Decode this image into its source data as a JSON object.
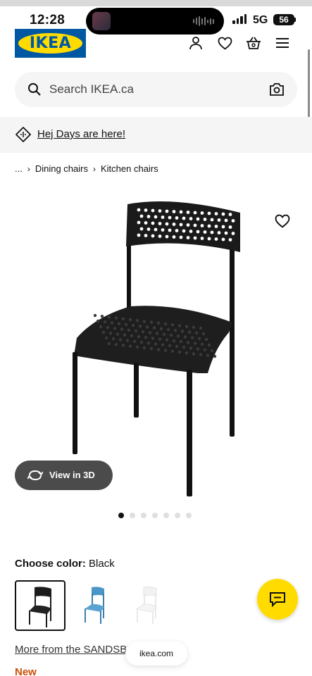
{
  "status_bar": {
    "time": "12:28",
    "network": "5G",
    "battery": "56"
  },
  "header": {
    "logo_text": "IKEA",
    "icons": [
      "profile-icon",
      "heart-icon",
      "basket-icon",
      "menu-icon"
    ]
  },
  "search": {
    "placeholder": "Search IKEA.ca"
  },
  "promo": {
    "label": "Hej Days are here!"
  },
  "breadcrumb": {
    "ellipsis": "...",
    "items": [
      "Dining chairs",
      "Kitchen chairs"
    ]
  },
  "product": {
    "view_3d_label": "View in 3D",
    "image_dots_total": 7,
    "image_dots_active": 1
  },
  "color": {
    "label": "Choose color:",
    "selected": "Black",
    "swatches": [
      {
        "color": "#1b1b1b"
      },
      {
        "color": "#4a96c6"
      },
      {
        "color": "#f2f2f2"
      }
    ]
  },
  "series_link": "More from the SANDSBERG series",
  "url": "ikea.com",
  "badge": "New",
  "colors": {
    "ikea_blue": "#0058a3",
    "ikea_yellow": "#ffdb00",
    "new_orange": "#ca5008"
  }
}
